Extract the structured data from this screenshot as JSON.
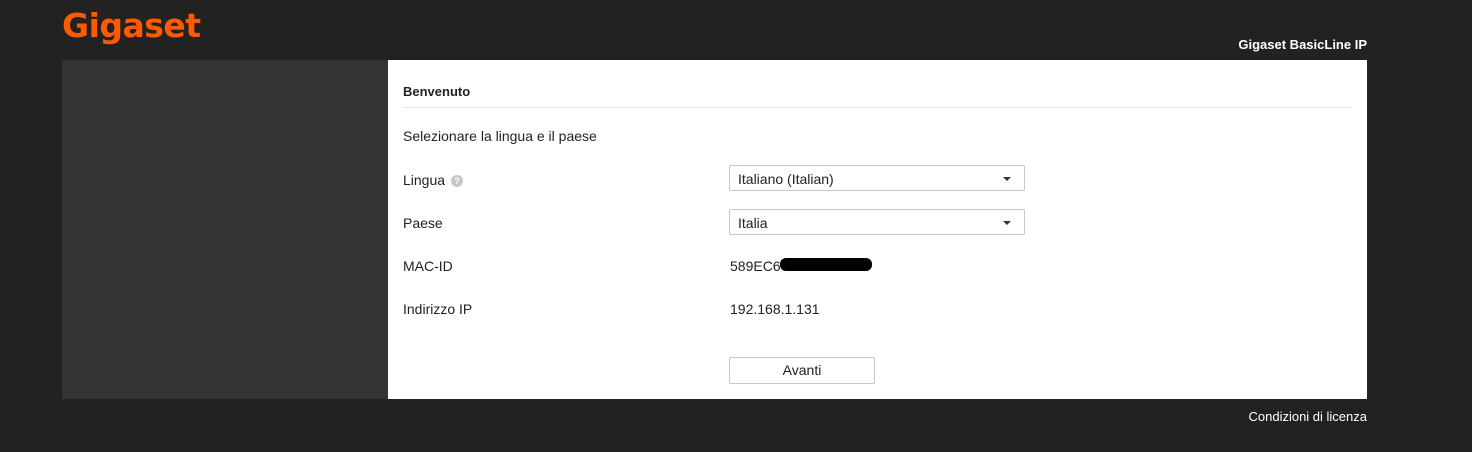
{
  "header": {
    "logo_text": "Gigaset",
    "product_name": "Gigaset BasicLine IP"
  },
  "colors": {
    "brand": "#ff5a00",
    "background": "#222222",
    "sidebar": "#333333",
    "content": "#ffffff"
  },
  "main": {
    "title": "Benvenuto",
    "intro": "Selezionare la lingua e il paese",
    "language": {
      "label": "Lingua",
      "help_icon": "question-circle-icon",
      "selected": "Italiano (Italian)"
    },
    "country": {
      "label": "Paese",
      "selected": "Italia"
    },
    "mac": {
      "label": "MAC-ID",
      "value_visible": "589EC6"
    },
    "ip": {
      "label": "Indirizzo IP",
      "value": "192.168.1.131"
    },
    "next_button": "Avanti"
  },
  "footer": {
    "license_link": "Condizioni di licenza"
  }
}
